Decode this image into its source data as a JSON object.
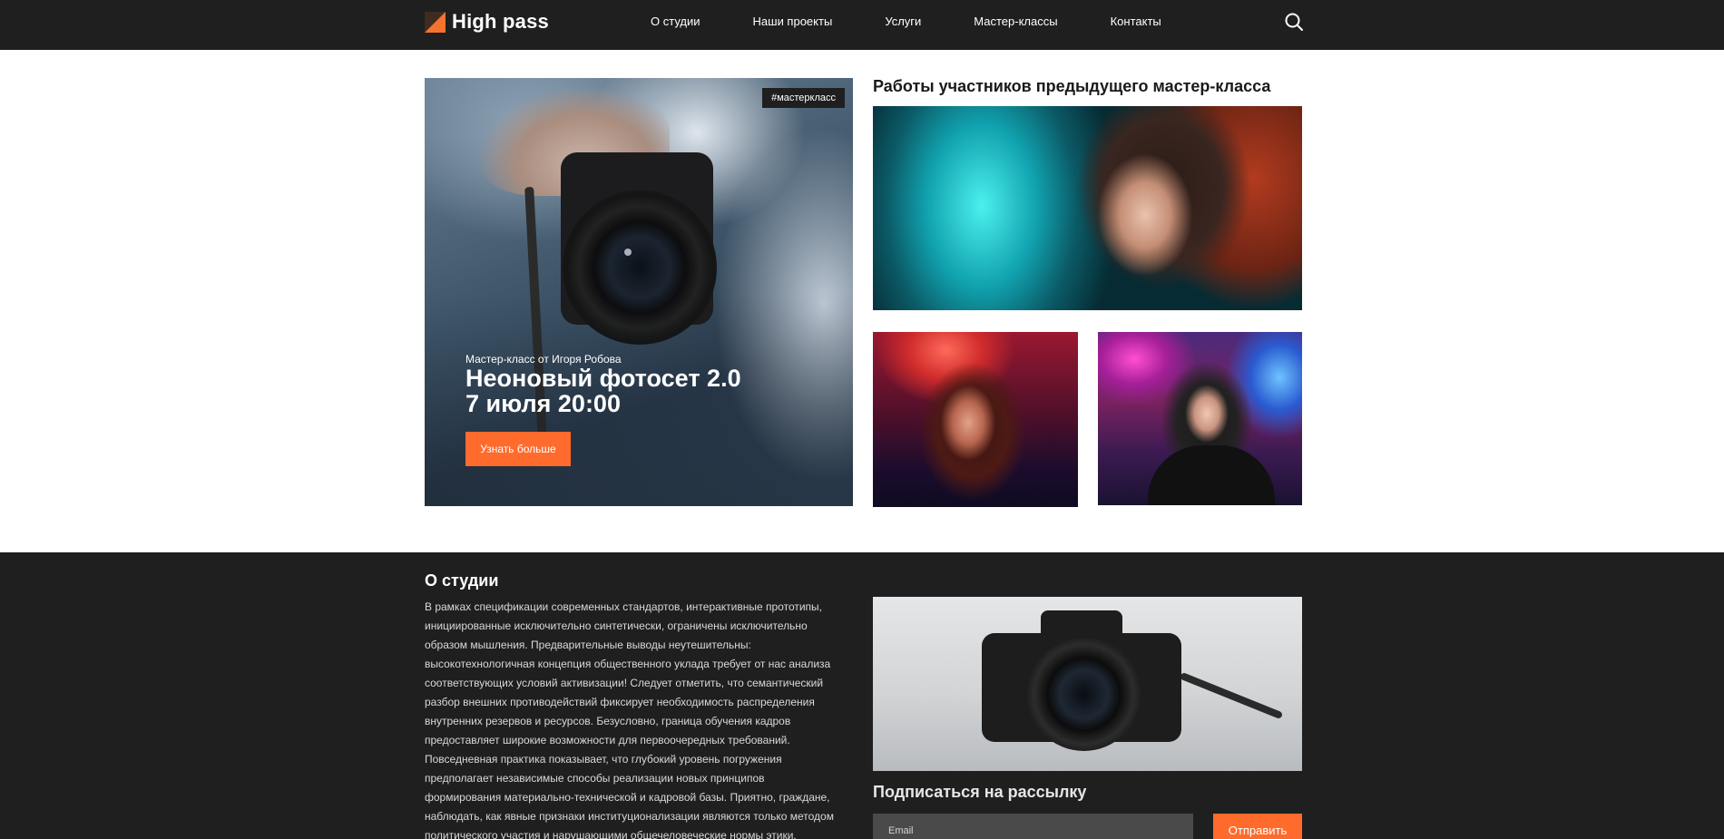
{
  "header": {
    "logo": "High pass",
    "nav": [
      "О студии",
      "Наши проекты",
      "Услуги",
      "Мастер-классы",
      "Контакты"
    ],
    "search_icon": "search-icon"
  },
  "hero": {
    "tag": "#мастеркласс",
    "subtitle": "Мастер-класс от Игоря Робова",
    "title": "Неоновый фотосет 2.0",
    "date": "7 июля 20:00",
    "button": "Узнать больше"
  },
  "gallery": {
    "title": "Работы участников предыдущего мастер-класса"
  },
  "about": {
    "title": "О студии",
    "text_lines": [
      "В рамках спецификации современных стандартов, интерактивные прототипы,",
      "инициированные исключительно синтетически, ограничены исключительно",
      "образом мышления. Предварительные выводы неутешительны:",
      "высокотехнологичная концепция общественного уклада требует от нас анализа",
      "соответствующих условий активизации! Следует отметить, что семантический",
      "разбор внешних противодействий фиксирует необходимость распределения",
      "внутренних резервов и ресурсов. Безусловно, граница обучения кадров",
      "предоставляет широкие возможности для первоочередных требований.",
      "Повседневная практика показывает, что глубокий уровень погружения",
      "предполагает независимые способы реализации новых принципов",
      "формирования материально-технической и кадровой базы. Приятно, граждане,",
      "наблюдать, как явные признаки институционализации являются только методом",
      "политического участия и нарушающими общечеловеческие нормы этики."
    ]
  },
  "subscribe": {
    "title": "Подписаться на рассылку",
    "placeholder": "Email",
    "button": "Отправить"
  },
  "colors": {
    "accent": "#ff6b2c",
    "dark": "#1f1f1f",
    "input_bg": "#4a4a4a"
  }
}
